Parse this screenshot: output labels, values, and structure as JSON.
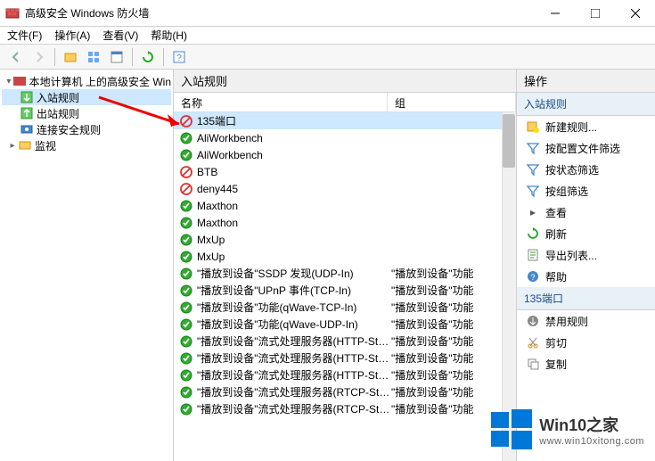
{
  "window": {
    "title": "高级安全 Windows 防火墙"
  },
  "menu": {
    "file": "文件(F)",
    "action": "操作(A)",
    "view": "查看(V)",
    "help": "帮助(H)"
  },
  "tree": {
    "root": "本地计算机 上的高级安全 Win",
    "inbound": "入站规则",
    "outbound": "出站规则",
    "connsec": "连接安全规则",
    "monitor": "监视"
  },
  "center": {
    "header": "入站规则",
    "col_name": "名称",
    "col_group": "组"
  },
  "rules": [
    {
      "icon": "block",
      "name": "135端口",
      "group": "",
      "selected": true
    },
    {
      "icon": "allow",
      "name": "AliWorkbench",
      "group": ""
    },
    {
      "icon": "allow",
      "name": "AliWorkbench",
      "group": ""
    },
    {
      "icon": "block",
      "name": "BTB",
      "group": ""
    },
    {
      "icon": "block",
      "name": "deny445",
      "group": ""
    },
    {
      "icon": "allow",
      "name": "Maxthon",
      "group": ""
    },
    {
      "icon": "allow",
      "name": "Maxthon",
      "group": ""
    },
    {
      "icon": "allow",
      "name": "MxUp",
      "group": ""
    },
    {
      "icon": "allow",
      "name": "MxUp",
      "group": ""
    },
    {
      "icon": "allow",
      "name": "\"播放到设备\"SSDP 发现(UDP-In)",
      "group": "\"播放到设备\"功能"
    },
    {
      "icon": "allow",
      "name": "\"播放到设备\"UPnP 事件(TCP-In)",
      "group": "\"播放到设备\"功能"
    },
    {
      "icon": "allow",
      "name": "\"播放到设备\"功能(qWave-TCP-In)",
      "group": "\"播放到设备\"功能"
    },
    {
      "icon": "allow",
      "name": "\"播放到设备\"功能(qWave-UDP-In)",
      "group": "\"播放到设备\"功能"
    },
    {
      "icon": "allow",
      "name": "\"播放到设备\"流式处理服务器(HTTP-Stre...",
      "group": "\"播放到设备\"功能"
    },
    {
      "icon": "allow",
      "name": "\"播放到设备\"流式处理服务器(HTTP-Stre...",
      "group": "\"播放到设备\"功能"
    },
    {
      "icon": "allow",
      "name": "\"播放到设备\"流式处理服务器(HTTP-Stre...",
      "group": "\"播放到设备\"功能"
    },
    {
      "icon": "allow",
      "name": "\"播放到设备\"流式处理服务器(RTCP-Stre...",
      "group": "\"播放到设备\"功能"
    },
    {
      "icon": "allow",
      "name": "\"播放到设备\"流式处理服务器(RTCP-Stre...",
      "group": "\"播放到设备\"功能"
    }
  ],
  "actions": {
    "header": "操作",
    "group1": "入站规则",
    "items1": [
      {
        "icon": "new",
        "label": "新建规则..."
      },
      {
        "icon": "filter",
        "label": "按配置文件筛选"
      },
      {
        "icon": "filter",
        "label": "按状态筛选"
      },
      {
        "icon": "filter",
        "label": "按组筛选"
      },
      {
        "icon": "view",
        "label": "查看"
      },
      {
        "icon": "refresh",
        "label": "刷新"
      },
      {
        "icon": "export",
        "label": "导出列表..."
      },
      {
        "icon": "help",
        "label": "帮助"
      }
    ],
    "group2": "135端口",
    "items2": [
      {
        "icon": "disable",
        "label": "禁用规则"
      },
      {
        "icon": "cut",
        "label": "剪切"
      },
      {
        "icon": "copy",
        "label": "复制"
      }
    ]
  },
  "watermark": {
    "brand": "Win10之家",
    "url": "www.win10xitong.com"
  }
}
